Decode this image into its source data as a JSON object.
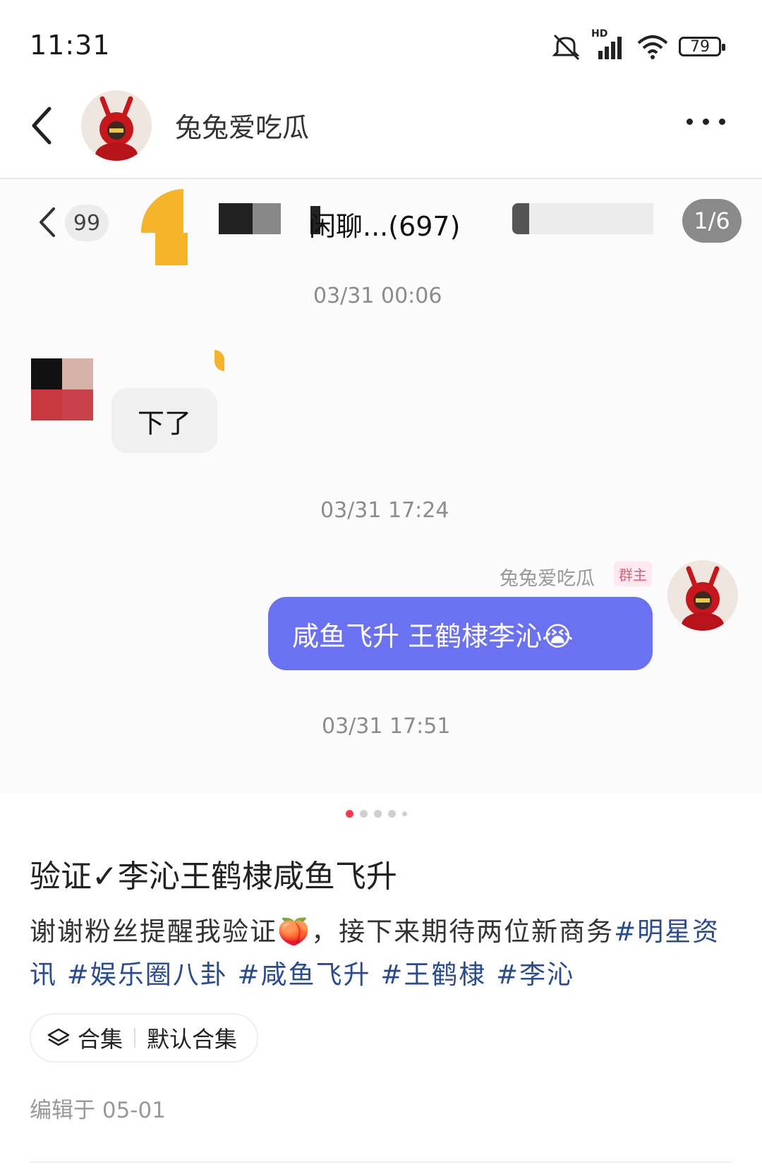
{
  "status_bar": {
    "time": "11:31",
    "battery": "79",
    "network_label": "HD"
  },
  "header": {
    "user_name": "兔兔爱吃瓜"
  },
  "chat": {
    "unread_count": "99",
    "group_title": "闲聊...(697)",
    "page_indicator": "1/6",
    "timestamps": [
      "03/31 00:06",
      "03/31 17:24",
      "03/31 17:51"
    ],
    "msg_left": "下了",
    "sender_name": "兔兔爱吃瓜",
    "owner_badge": "群主",
    "msg_right": "咸鱼飞升  王鹤棣李沁😭"
  },
  "carousel": {
    "count": 5,
    "active_index": 0
  },
  "post": {
    "title": "验证✓李沁王鹤棣咸鱼飞升",
    "body_text": "谢谢粉丝提醒我验证🍑，接下来期待两位新商务",
    "tags": [
      "#明星资讯",
      "#娱乐圈八卦",
      "#咸鱼飞升",
      "#王鹤棣",
      "#李沁"
    ],
    "collection_label": "合集",
    "collection_name": "默认合集",
    "edit_time": "编辑于 05-01"
  }
}
